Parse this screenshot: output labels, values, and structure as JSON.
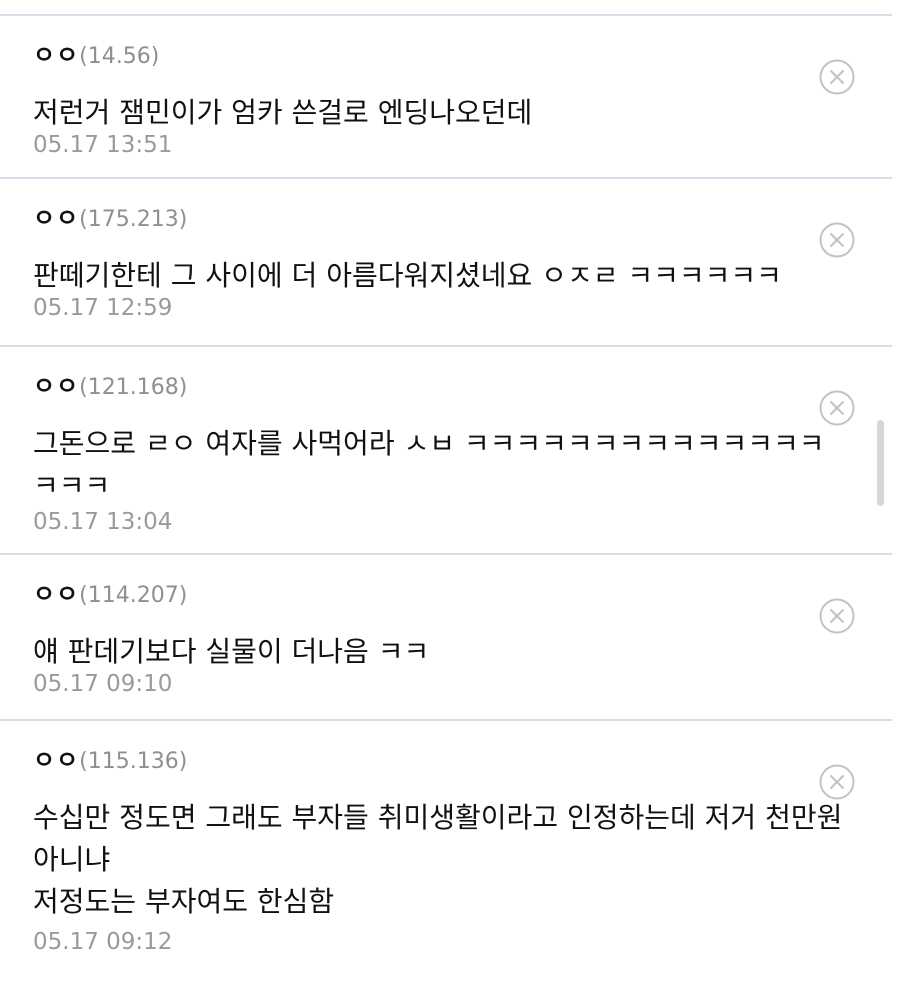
{
  "comments": [
    {
      "nick": "ㅇㅇ",
      "ip": "(14.56)",
      "text": "저런거 잼민이가 엄카 쓴걸로 엔딩나오던데",
      "time": "05.17 13:51"
    },
    {
      "nick": "ㅇㅇ",
      "ip": "(175.213)",
      "text": "판떼기한테 그 사이에 더 아름다워지셨네요 ㅇㅈㄹ ㅋㅋㅋㅋㅋㅋ",
      "time": "05.17 12:59"
    },
    {
      "nick": "ㅇㅇ",
      "ip": "(121.168)",
      "text": "그돈으로 ㄹㅇ 여자를 사먹어라 ㅅㅂ ㅋㅋㅋㅋㅋㅋㅋㅋㅋㅋㅋㅋㅋㅋ\nㅋㅋㅋ",
      "time": "05.17 13:04"
    },
    {
      "nick": "ㅇㅇ",
      "ip": "(114.207)",
      "text": "얘 판데기보다 실물이 더나음 ㅋㅋ",
      "time": "05.17 09:10"
    },
    {
      "nick": "ㅇㅇ",
      "ip": "(115.136)",
      "text": "수십만 정도면 그래도 부자들 취미생활이라고 인정하는데 저거 천만원\n아니냐\n저정도는 부자여도 한심함",
      "time": "05.17 09:12"
    }
  ],
  "icons": {
    "delete": "close-circle-icon"
  },
  "colors": {
    "divider": "#dcdcec",
    "meta": "#9a9a9a",
    "icon": "#c2c2c2"
  }
}
